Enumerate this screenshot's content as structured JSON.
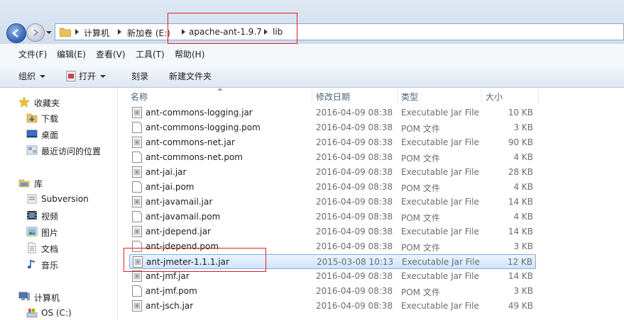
{
  "address": {
    "crumbs": [
      "计算机",
      "新加卷 (E:)",
      "apache-ant-1.9.7",
      "lib"
    ]
  },
  "menu": [
    "文件(F)",
    "编辑(E)",
    "查看(V)",
    "工具(T)",
    "帮助(H)"
  ],
  "toolbar": {
    "organize": "组织",
    "open": "打开",
    "burn": "刻录",
    "new_folder": "新建文件夹"
  },
  "nav": {
    "favorites": "收藏夹",
    "downloads": "下载",
    "desktop": "桌面",
    "recent": "最近访问的位置",
    "libraries": "库",
    "subversion": "Subversion",
    "videos": "视频",
    "pictures": "图片",
    "documents": "文档",
    "music": "音乐",
    "computer": "计算机",
    "os_drive": "OS (C:)"
  },
  "columns": {
    "name": "名称",
    "date": "修改日期",
    "type": "类型",
    "size": "大小"
  },
  "files": [
    {
      "name": "ant-commons-logging.jar",
      "date": "2016-04-09 08:38",
      "type": "Executable Jar File",
      "size": "10 KB",
      "kind": "jar"
    },
    {
      "name": "ant-commons-logging.pom",
      "date": "2016-04-09 08:38",
      "type": "POM 文件",
      "size": "3 KB",
      "kind": "pom"
    },
    {
      "name": "ant-commons-net.jar",
      "date": "2016-04-09 08:38",
      "type": "Executable Jar File",
      "size": "90 KB",
      "kind": "jar"
    },
    {
      "name": "ant-commons-net.pom",
      "date": "2016-04-09 08:38",
      "type": "POM 文件",
      "size": "4 KB",
      "kind": "pom"
    },
    {
      "name": "ant-jai.jar",
      "date": "2016-04-09 08:38",
      "type": "Executable Jar File",
      "size": "28 KB",
      "kind": "jar"
    },
    {
      "name": "ant-jai.pom",
      "date": "2016-04-09 08:38",
      "type": "POM 文件",
      "size": "4 KB",
      "kind": "pom"
    },
    {
      "name": "ant-javamail.jar",
      "date": "2016-04-09 08:38",
      "type": "Executable Jar File",
      "size": "14 KB",
      "kind": "jar"
    },
    {
      "name": "ant-javamail.pom",
      "date": "2016-04-09 08:38",
      "type": "POM 文件",
      "size": "4 KB",
      "kind": "pom"
    },
    {
      "name": "ant-jdepend.jar",
      "date": "2016-04-09 08:38",
      "type": "Executable Jar File",
      "size": "14 KB",
      "kind": "jar"
    },
    {
      "name": "ant-jdepend.pom",
      "date": "2016-04-09 08:38",
      "type": "POM 文件",
      "size": "3 KB",
      "kind": "pom"
    },
    {
      "name": "ant-jmeter-1.1.1.jar",
      "date": "2015-03-08 10:13",
      "type": "Executable Jar File",
      "size": "12 KB",
      "kind": "jar",
      "selected": true
    },
    {
      "name": "ant-jmf.jar",
      "date": "2016-04-09 08:38",
      "type": "Executable Jar File",
      "size": "14 KB",
      "kind": "jar"
    },
    {
      "name": "ant-jmf.pom",
      "date": "2016-04-09 08:38",
      "type": "POM 文件",
      "size": "3 KB",
      "kind": "pom"
    },
    {
      "name": "ant-jsch.jar",
      "date": "2016-04-09 08:38",
      "type": "Executable Jar File",
      "size": "49 KB",
      "kind": "jar"
    }
  ]
}
